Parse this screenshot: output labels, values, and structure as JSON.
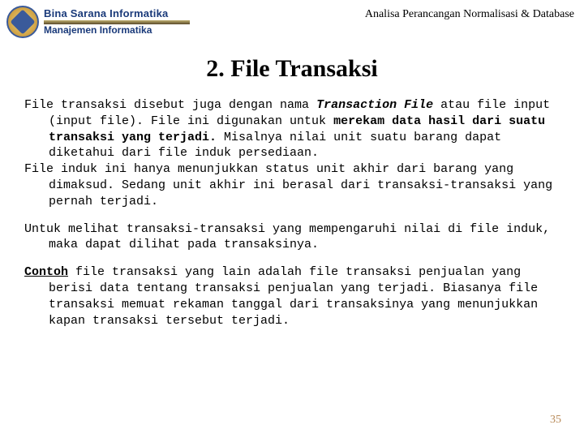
{
  "header": {
    "brand_top": "Bina Sarana Informatika",
    "brand_bottom": "Manajemen Informatika",
    "doc_title": "Analisa Perancangan Normalisasi & Database"
  },
  "heading": "2. File Transaksi",
  "para1": {
    "t1": "File transaksi disebut juga dengan nama ",
    "bi1": "Transaction File",
    "t2": " atau file input (input file). File ini digunakan untuk ",
    "b1": "merekam data hasil dari suatu transaksi yang terjadi.",
    "t3": " Misalnya nilai unit suatu barang dapat diketahui dari file induk persediaan."
  },
  "para2": "File induk ini hanya menunjukkan status unit akhir dari barang yang dimaksud. Sedang unit akhir ini berasal dari transaksi-transaksi yang pernah terjadi.",
  "para3": "Untuk melihat transaksi-transaksi yang mempengaruhi nilai di file induk, maka dapat dilihat pada transaksinya.",
  "para4": {
    "u1": "Contoh",
    "t1": " file transaksi yang lain adalah file transaksi penjualan yang berisi data tentang transaksi penjualan yang terjadi. Biasanya file transaksi memuat rekaman tanggal dari transaksinya yang menunjukkan kapan transaksi tersebut terjadi."
  },
  "page_number": "35"
}
